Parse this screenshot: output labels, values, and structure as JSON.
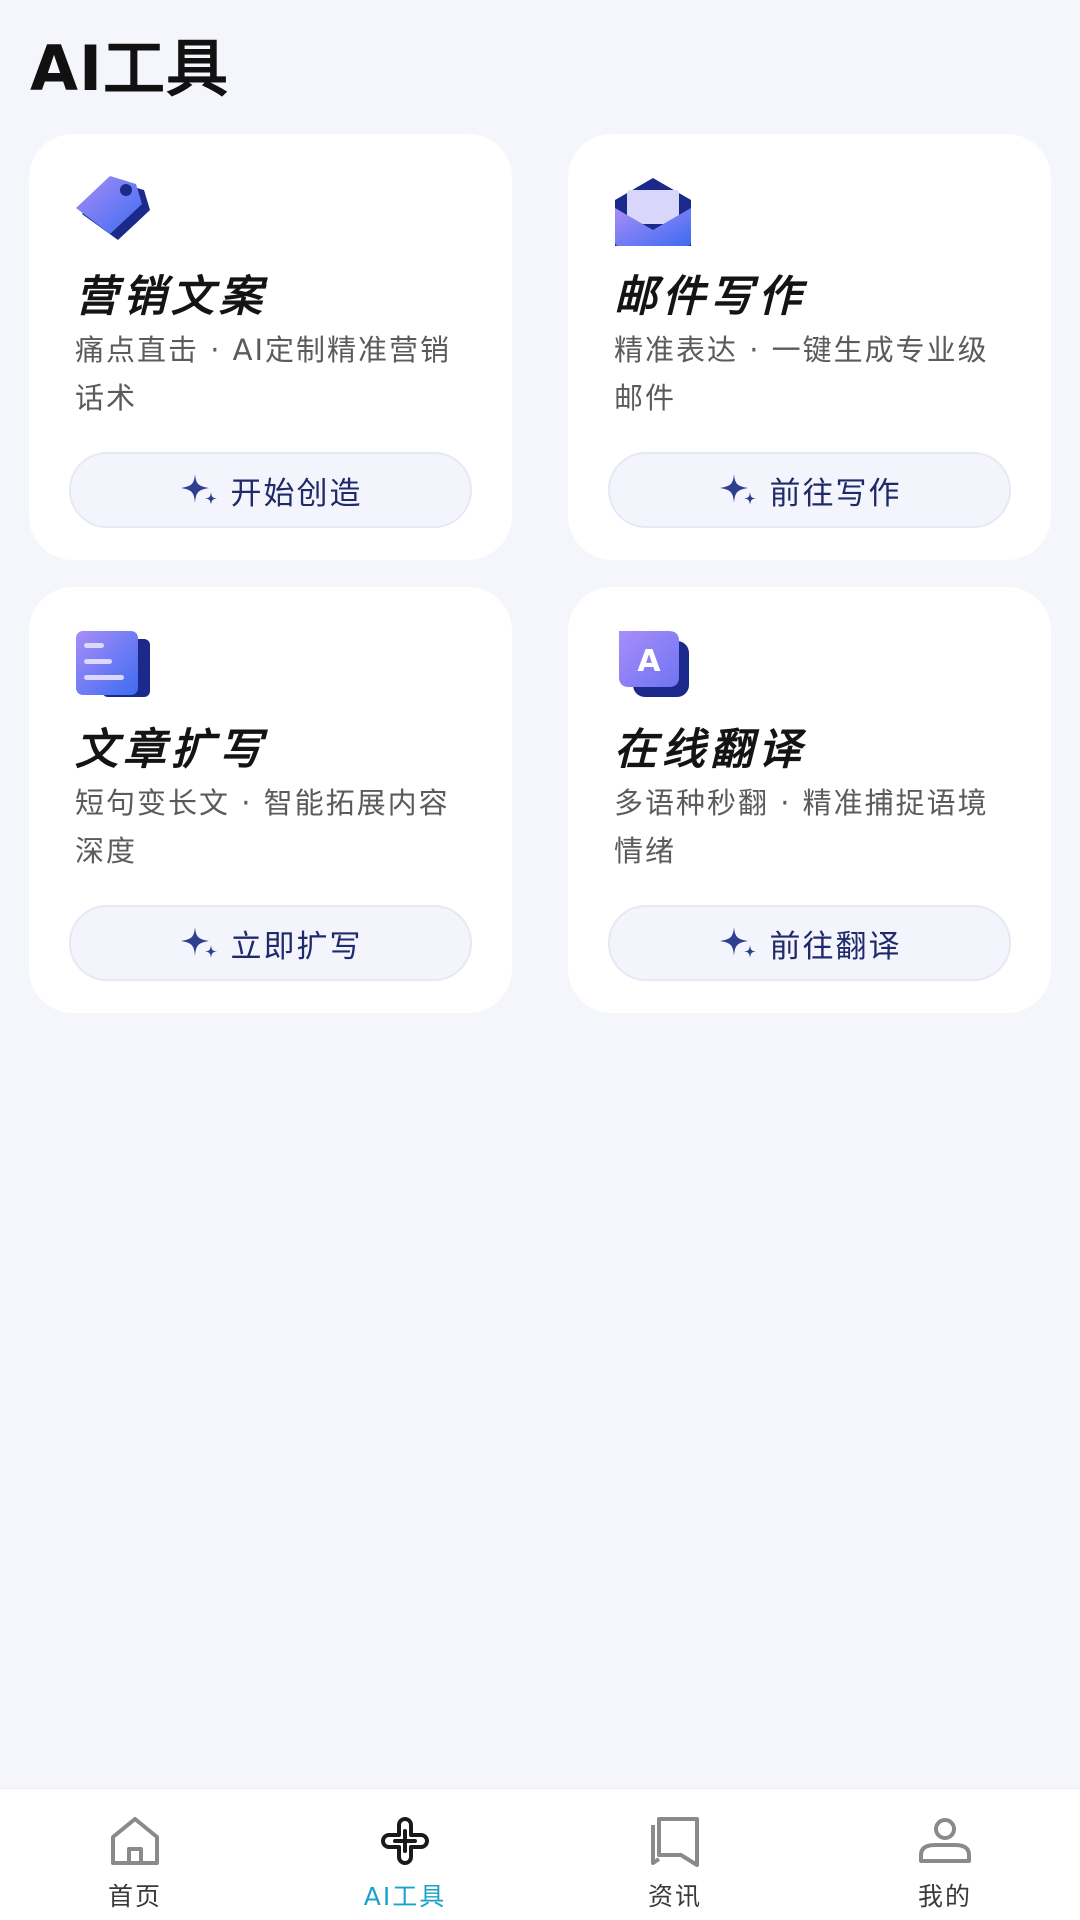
{
  "page": {
    "title": "AI工具"
  },
  "cards": [
    {
      "title": "营销文案",
      "desc": "痛点直击 · AI定制精准营销话术",
      "button": "开始创造",
      "icon": "price-tag-icon"
    },
    {
      "title": "邮件写作",
      "desc": "精准表达 · 一键生成专业级邮件",
      "button": "前往写作",
      "icon": "envelope-icon"
    },
    {
      "title": "文章扩写",
      "desc": "短句变长文 · 智能拓展内容深度",
      "button": "立即扩写",
      "icon": "document-icon"
    },
    {
      "title": "在线翻译",
      "desc": "多语种秒翻 · 精准捕捉语境情绪",
      "button": "前往翻译",
      "icon": "translate-icon"
    }
  ],
  "tabbar": {
    "items": [
      {
        "label": "首页",
        "icon": "home-icon",
        "active": false
      },
      {
        "label": "AI工具",
        "icon": "ai-tools-icon",
        "active": true
      },
      {
        "label": "资讯",
        "icon": "news-icon",
        "active": false
      },
      {
        "label": "我的",
        "icon": "profile-icon",
        "active": false
      }
    ]
  },
  "colors": {
    "background": "#f5f6fb",
    "card": "#ffffff",
    "button_text": "#1f2a6b",
    "active_tab": "#1aa3c9",
    "icon_gradient_start": "#8d7cf6",
    "icon_gradient_end": "#3f6ef0",
    "icon_dark": "#1b2a8a"
  }
}
